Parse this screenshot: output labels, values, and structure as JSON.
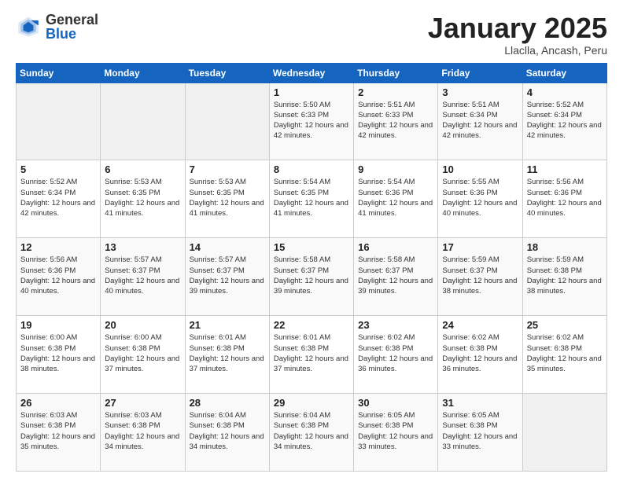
{
  "header": {
    "logo_general": "General",
    "logo_blue": "Blue",
    "title": "January 2025",
    "subtitle": "Llaclla, Ancash, Peru"
  },
  "days_of_week": [
    "Sunday",
    "Monday",
    "Tuesday",
    "Wednesday",
    "Thursday",
    "Friday",
    "Saturday"
  ],
  "weeks": [
    [
      {
        "day": "",
        "empty": true
      },
      {
        "day": "",
        "empty": true
      },
      {
        "day": "",
        "empty": true
      },
      {
        "day": "1",
        "sunrise": "5:50 AM",
        "sunset": "6:33 PM",
        "daylight": "12 hours and 42 minutes."
      },
      {
        "day": "2",
        "sunrise": "5:51 AM",
        "sunset": "6:33 PM",
        "daylight": "12 hours and 42 minutes."
      },
      {
        "day": "3",
        "sunrise": "5:51 AM",
        "sunset": "6:34 PM",
        "daylight": "12 hours and 42 minutes."
      },
      {
        "day": "4",
        "sunrise": "5:52 AM",
        "sunset": "6:34 PM",
        "daylight": "12 hours and 42 minutes."
      }
    ],
    [
      {
        "day": "5",
        "sunrise": "5:52 AM",
        "sunset": "6:34 PM",
        "daylight": "12 hours and 42 minutes."
      },
      {
        "day": "6",
        "sunrise": "5:53 AM",
        "sunset": "6:35 PM",
        "daylight": "12 hours and 41 minutes."
      },
      {
        "day": "7",
        "sunrise": "5:53 AM",
        "sunset": "6:35 PM",
        "daylight": "12 hours and 41 minutes."
      },
      {
        "day": "8",
        "sunrise": "5:54 AM",
        "sunset": "6:35 PM",
        "daylight": "12 hours and 41 minutes."
      },
      {
        "day": "9",
        "sunrise": "5:54 AM",
        "sunset": "6:36 PM",
        "daylight": "12 hours and 41 minutes."
      },
      {
        "day": "10",
        "sunrise": "5:55 AM",
        "sunset": "6:36 PM",
        "daylight": "12 hours and 40 minutes."
      },
      {
        "day": "11",
        "sunrise": "5:56 AM",
        "sunset": "6:36 PM",
        "daylight": "12 hours and 40 minutes."
      }
    ],
    [
      {
        "day": "12",
        "sunrise": "5:56 AM",
        "sunset": "6:36 PM",
        "daylight": "12 hours and 40 minutes."
      },
      {
        "day": "13",
        "sunrise": "5:57 AM",
        "sunset": "6:37 PM",
        "daylight": "12 hours and 40 minutes."
      },
      {
        "day": "14",
        "sunrise": "5:57 AM",
        "sunset": "6:37 PM",
        "daylight": "12 hours and 39 minutes."
      },
      {
        "day": "15",
        "sunrise": "5:58 AM",
        "sunset": "6:37 PM",
        "daylight": "12 hours and 39 minutes."
      },
      {
        "day": "16",
        "sunrise": "5:58 AM",
        "sunset": "6:37 PM",
        "daylight": "12 hours and 39 minutes."
      },
      {
        "day": "17",
        "sunrise": "5:59 AM",
        "sunset": "6:37 PM",
        "daylight": "12 hours and 38 minutes."
      },
      {
        "day": "18",
        "sunrise": "5:59 AM",
        "sunset": "6:38 PM",
        "daylight": "12 hours and 38 minutes."
      }
    ],
    [
      {
        "day": "19",
        "sunrise": "6:00 AM",
        "sunset": "6:38 PM",
        "daylight": "12 hours and 38 minutes."
      },
      {
        "day": "20",
        "sunrise": "6:00 AM",
        "sunset": "6:38 PM",
        "daylight": "12 hours and 37 minutes."
      },
      {
        "day": "21",
        "sunrise": "6:01 AM",
        "sunset": "6:38 PM",
        "daylight": "12 hours and 37 minutes."
      },
      {
        "day": "22",
        "sunrise": "6:01 AM",
        "sunset": "6:38 PM",
        "daylight": "12 hours and 37 minutes."
      },
      {
        "day": "23",
        "sunrise": "6:02 AM",
        "sunset": "6:38 PM",
        "daylight": "12 hours and 36 minutes."
      },
      {
        "day": "24",
        "sunrise": "6:02 AM",
        "sunset": "6:38 PM",
        "daylight": "12 hours and 36 minutes."
      },
      {
        "day": "25",
        "sunrise": "6:02 AM",
        "sunset": "6:38 PM",
        "daylight": "12 hours and 35 minutes."
      }
    ],
    [
      {
        "day": "26",
        "sunrise": "6:03 AM",
        "sunset": "6:38 PM",
        "daylight": "12 hours and 35 minutes."
      },
      {
        "day": "27",
        "sunrise": "6:03 AM",
        "sunset": "6:38 PM",
        "daylight": "12 hours and 34 minutes."
      },
      {
        "day": "28",
        "sunrise": "6:04 AM",
        "sunset": "6:38 PM",
        "daylight": "12 hours and 34 minutes."
      },
      {
        "day": "29",
        "sunrise": "6:04 AM",
        "sunset": "6:38 PM",
        "daylight": "12 hours and 34 minutes."
      },
      {
        "day": "30",
        "sunrise": "6:05 AM",
        "sunset": "6:38 PM",
        "daylight": "12 hours and 33 minutes."
      },
      {
        "day": "31",
        "sunrise": "6:05 AM",
        "sunset": "6:38 PM",
        "daylight": "12 hours and 33 minutes."
      },
      {
        "day": "",
        "empty": true
      }
    ]
  ]
}
